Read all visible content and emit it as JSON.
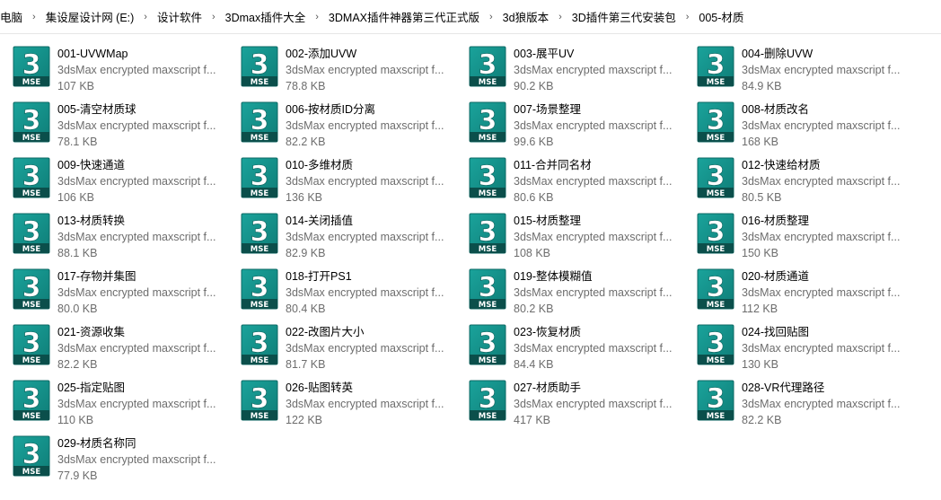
{
  "breadcrumb": [
    "电脑",
    "集设屋设计网 (E:)",
    "设计软件",
    "3Dmax插件大全",
    "3DMAX插件神器第三代正式版",
    "3d狼版本",
    "3D插件第三代安装包",
    "005-材质"
  ],
  "icon": {
    "name": "mse-file-icon",
    "glyph": "3",
    "badge": "MSE",
    "color": "#0f7d77",
    "color_light": "#1aa39b"
  },
  "files": [
    {
      "name": "001-UVWMap",
      "type": "3dsMax encrypted maxscript f...",
      "size": "107 KB"
    },
    {
      "name": "002-添加UVW",
      "type": "3dsMax encrypted maxscript f...",
      "size": "78.8 KB"
    },
    {
      "name": "003-展平UV",
      "type": "3dsMax encrypted maxscript f...",
      "size": "90.2 KB"
    },
    {
      "name": "004-删除UVW",
      "type": "3dsMax encrypted maxscript f...",
      "size": "84.9 KB"
    },
    {
      "name": "005-清空材质球",
      "type": "3dsMax encrypted maxscript f...",
      "size": "78.1 KB"
    },
    {
      "name": "006-按材质ID分离",
      "type": "3dsMax encrypted maxscript f...",
      "size": "82.2 KB"
    },
    {
      "name": "007-场景整理",
      "type": "3dsMax encrypted maxscript f...",
      "size": "99.6 KB"
    },
    {
      "name": "008-材质改名",
      "type": "3dsMax encrypted maxscript f...",
      "size": "168 KB"
    },
    {
      "name": "009-快速通道",
      "type": "3dsMax encrypted maxscript f...",
      "size": "106 KB"
    },
    {
      "name": "010-多维材质",
      "type": "3dsMax encrypted maxscript f...",
      "size": "136 KB"
    },
    {
      "name": "011-合并同名材",
      "type": "3dsMax encrypted maxscript f...",
      "size": "80.6 KB"
    },
    {
      "name": "012-快速给材质",
      "type": "3dsMax encrypted maxscript f...",
      "size": "80.5 KB"
    },
    {
      "name": "013-材质转换",
      "type": "3dsMax encrypted maxscript f...",
      "size": "88.1 KB"
    },
    {
      "name": "014-关闭插值",
      "type": "3dsMax encrypted maxscript f...",
      "size": "82.9 KB"
    },
    {
      "name": "015-材质整理",
      "type": "3dsMax encrypted maxscript f...",
      "size": "108 KB"
    },
    {
      "name": "016-材质整理",
      "type": "3dsMax encrypted maxscript f...",
      "size": "150 KB"
    },
    {
      "name": "017-存物并集图",
      "type": "3dsMax encrypted maxscript f...",
      "size": "80.0 KB"
    },
    {
      "name": "018-打开PS1",
      "type": "3dsMax encrypted maxscript f...",
      "size": "80.4 KB"
    },
    {
      "name": "019-整体模糊值",
      "type": "3dsMax encrypted maxscript f...",
      "size": "80.2 KB"
    },
    {
      "name": "020-材质通道",
      "type": "3dsMax encrypted maxscript f...",
      "size": "112 KB"
    },
    {
      "name": "021-资源收集",
      "type": "3dsMax encrypted maxscript f...",
      "size": "82.2 KB"
    },
    {
      "name": "022-改图片大小",
      "type": "3dsMax encrypted maxscript f...",
      "size": "81.7 KB"
    },
    {
      "name": "023-恢复材质",
      "type": "3dsMax encrypted maxscript f...",
      "size": "84.4 KB"
    },
    {
      "name": "024-找回贴图",
      "type": "3dsMax encrypted maxscript f...",
      "size": "130 KB"
    },
    {
      "name": "025-指定贴图",
      "type": "3dsMax encrypted maxscript f...",
      "size": "110 KB"
    },
    {
      "name": "026-贴图转英",
      "type": "3dsMax encrypted maxscript f...",
      "size": "122 KB"
    },
    {
      "name": "027-材质助手",
      "type": "3dsMax encrypted maxscript f...",
      "size": "417 KB"
    },
    {
      "name": "028-VR代理路径",
      "type": "3dsMax encrypted maxscript f...",
      "size": "82.2 KB"
    },
    {
      "name": "029-材质名称同",
      "type": "3dsMax encrypted maxscript f...",
      "size": "77.9 KB"
    }
  ]
}
